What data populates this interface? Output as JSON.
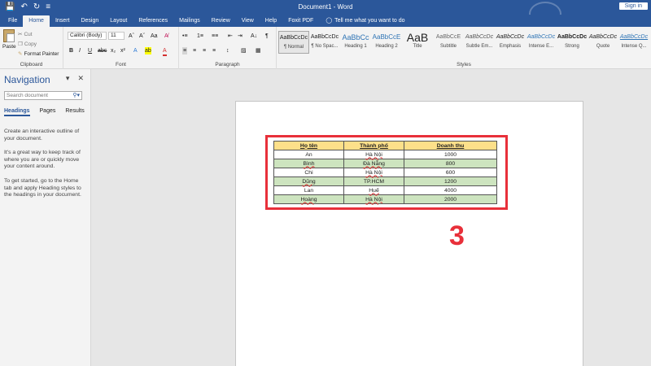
{
  "titlebar": {
    "doc_title": "Document1 - Word",
    "signin_label": "Sign in",
    "qat": {
      "save": "💾",
      "undo": "↶",
      "redo": "↻",
      "customize": "≡"
    }
  },
  "tabs": [
    "File",
    "Home",
    "Insert",
    "Design",
    "Layout",
    "References",
    "Mailings",
    "Review",
    "View",
    "Help",
    "Foxit PDF"
  ],
  "tell_me": "Tell me what you want to do",
  "clipboard": {
    "paste": "Paste",
    "cut": "Cut",
    "copy": "Copy",
    "format_painter": "Format Painter",
    "group_label": "Clipboard"
  },
  "font": {
    "family": "Calibri (Body)",
    "size": "11",
    "grow": "Aˆ",
    "shrink": "Aˇ",
    "case": "Aa",
    "clear": "A̸",
    "bold": "B",
    "italic": "I",
    "underline": "U",
    "strike": "abc",
    "subscript": "x₂",
    "superscript": "x²",
    "text_effects": "A",
    "highlight": "ab",
    "font_color": "A",
    "group_label": "Font"
  },
  "paragraph": {
    "bullets": "•≡",
    "numbering": "1≡",
    "multilevel": "≡≡",
    "decrease_indent": "⇤",
    "increase_indent": "⇥",
    "sort": "A↓",
    "show_marks": "¶",
    "align_left": "≡",
    "center": "≡",
    "align_right": "≡",
    "justify": "≡",
    "line_spacing": "↕",
    "shading": "▨",
    "borders": "▦",
    "group_label": "Paragraph"
  },
  "styles": {
    "group_label": "Styles",
    "items": [
      {
        "sample": "AaBbCcDc",
        "name": "¶ Normal"
      },
      {
        "sample": "AaBbCcDc",
        "name": "¶ No Spac..."
      },
      {
        "sample": "AaBbCc",
        "name": "Heading 1"
      },
      {
        "sample": "AaBbCcE",
        "name": "Heading 2"
      },
      {
        "sample": "AaB",
        "name": "Title"
      },
      {
        "sample": "AaBbCcE",
        "name": "Subtitle"
      },
      {
        "sample": "AaBbCcDc",
        "name": "Subtle Em..."
      },
      {
        "sample": "AaBbCcDc",
        "name": "Emphasis"
      },
      {
        "sample": "AaBbCcDc",
        "name": "Intense E..."
      },
      {
        "sample": "AaBbCcDc",
        "name": "Strong"
      },
      {
        "sample": "AaBbCcDc",
        "name": "Quote"
      },
      {
        "sample": "AaBbCcDc",
        "name": "Intense Q..."
      }
    ]
  },
  "navigation": {
    "title": "Navigation",
    "search_placeholder": "Search document",
    "tabs": [
      "Headings",
      "Pages",
      "Results"
    ],
    "paragraphs": [
      "Create an interactive outline of your document.",
      "It's a great way to keep track of where you are or quickly move your content around.",
      "To get started, go to the Home tab and apply Heading styles to the headings in your document."
    ]
  },
  "document": {
    "table": {
      "headers": [
        "Họ tên",
        "Thành phố",
        "Doanh thu"
      ],
      "rows": [
        [
          "An",
          "Hà Nội",
          "1000"
        ],
        [
          "Bình",
          "Đà Nẵng",
          "800"
        ],
        [
          "Chi",
          "Hà Nội",
          "600"
        ],
        [
          "Dũng",
          "TP.HCM",
          "1200"
        ],
        [
          "Lan",
          "Huế",
          "4000"
        ],
        [
          "Hoàng",
          "Hà Nội",
          "2000"
        ]
      ]
    },
    "step_number": "3",
    "colors": {
      "header_fill": "#fde08a",
      "row_fill": "#cde4bf",
      "highlight": "#e8303a"
    }
  },
  "colors": {
    "accent": "#2b579a"
  }
}
